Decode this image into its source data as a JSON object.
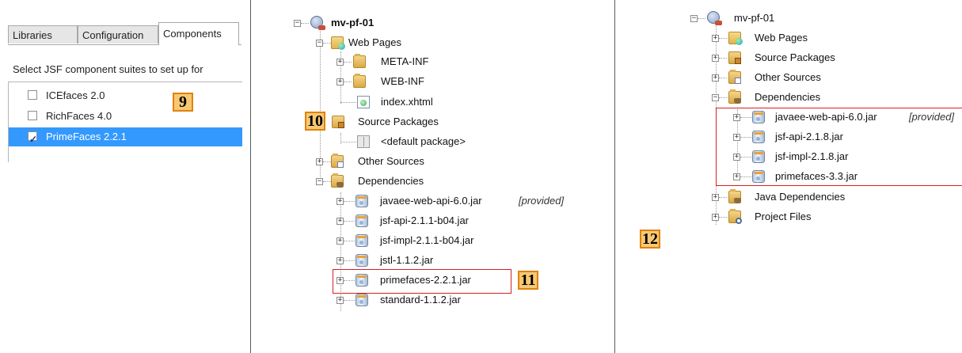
{
  "jsf_dialog": {
    "tabs": [
      {
        "label": "Libraries",
        "active": false
      },
      {
        "label": "Configuration",
        "active": false
      },
      {
        "label": "Components",
        "active": true
      }
    ],
    "prompt": "Select JSF component suites to set up for",
    "components": [
      {
        "label": "ICEfaces 2.0",
        "checked": false
      },
      {
        "label": "RichFaces 4.0",
        "checked": false
      },
      {
        "label": "PrimeFaces 2.2.1",
        "checked": true
      }
    ],
    "selection_color": "#3399ff"
  },
  "callouts": [
    "9",
    "10",
    "11",
    "12"
  ],
  "tree_before": {
    "project": "mv-pf-01",
    "web_pages": "Web Pages",
    "meta_inf": "META-INF",
    "web_inf": "WEB-INF",
    "index": "index.xhtml",
    "source_packages": "Source Packages",
    "default_package": "<default package>",
    "other_sources": "Other Sources",
    "dependencies": "Dependencies",
    "jars": [
      {
        "name": "javaee-web-api-6.0.jar",
        "hint": "[provided]"
      },
      {
        "name": "jsf-api-2.1.1-b04.jar",
        "hint": ""
      },
      {
        "name": "jsf-impl-2.1.1-b04.jar",
        "hint": ""
      },
      {
        "name": "jstl-1.1.2.jar",
        "hint": ""
      },
      {
        "name": "primefaces-2.2.1.jar",
        "hint": ""
      },
      {
        "name": "standard-1.1.2.jar",
        "hint": ""
      }
    ]
  },
  "tree_after": {
    "project": "mv-pf-01",
    "web_pages": "Web Pages",
    "source_packages": "Source Packages",
    "other_sources": "Other Sources",
    "dependencies": "Dependencies",
    "jars": [
      {
        "name": "javaee-web-api-6.0.jar",
        "hint": "[provided]"
      },
      {
        "name": "jsf-api-2.1.8.jar",
        "hint": ""
      },
      {
        "name": "jsf-impl-2.1.8.jar",
        "hint": ""
      },
      {
        "name": "primefaces-3.3.jar",
        "hint": ""
      }
    ],
    "java_dependencies": "Java Dependencies",
    "project_files": "Project Files"
  },
  "colors": {
    "highlight_box": "#d62020",
    "callout_fill": "#f7c873",
    "callout_border": "#e0820a"
  }
}
